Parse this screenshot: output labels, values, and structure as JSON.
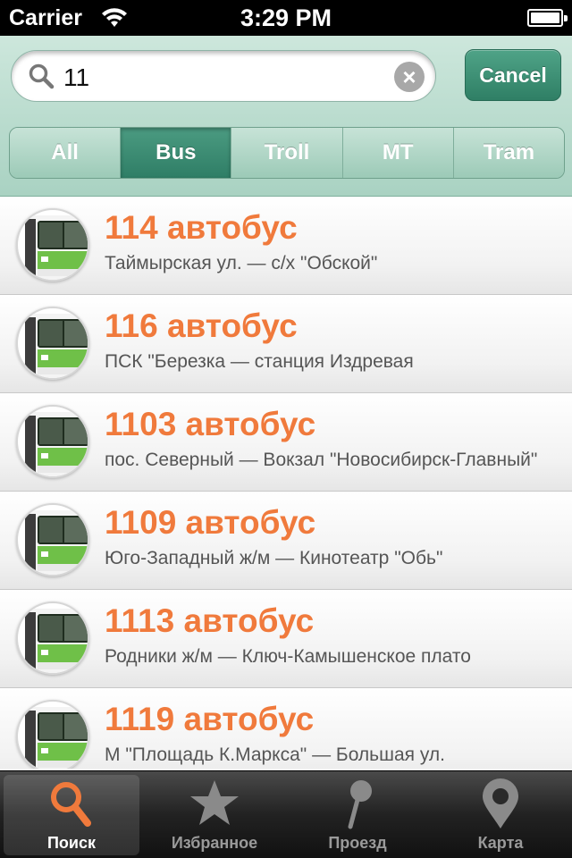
{
  "status_bar": {
    "carrier": "Carrier",
    "time": "3:29 PM"
  },
  "search": {
    "query": "11",
    "cancel_label": "Cancel"
  },
  "segments": [
    {
      "label": "All",
      "active": false
    },
    {
      "label": "Bus",
      "active": true
    },
    {
      "label": "Troll",
      "active": false
    },
    {
      "label": "MT",
      "active": false
    },
    {
      "label": "Tram",
      "active": false
    }
  ],
  "routes": [
    {
      "title": "114 автобус",
      "subtitle": "Таймырская ул. — с/х \"Обской\""
    },
    {
      "title": "116 автобус",
      "subtitle": "ПСК \"Березка — станция Издревая"
    },
    {
      "title": "1103 автобус",
      "subtitle": "пос. Северный — Вокзал \"Новосибирск-Главный\""
    },
    {
      "title": "1109 автобус",
      "subtitle": "Юго-Западный ж/м — Кинотеатр \"Обь\""
    },
    {
      "title": "1113 автобус",
      "subtitle": "Родники ж/м — Ключ-Камышенское плато"
    },
    {
      "title": "1119 автобус",
      "subtitle": "М \"Площадь К.Маркса\" — Большая ул."
    }
  ],
  "tabs": [
    {
      "label": "Поиск",
      "icon": "search-icon",
      "active": true
    },
    {
      "label": "Избранное",
      "icon": "star-icon",
      "active": false
    },
    {
      "label": "Проезд",
      "icon": "pin-icon",
      "active": false
    },
    {
      "label": "Карта",
      "icon": "map-marker-icon",
      "active": false
    }
  ],
  "colors": {
    "accent": "#f07a3c",
    "header": "#a9d2c2",
    "active_segment": "#2f7e66"
  }
}
